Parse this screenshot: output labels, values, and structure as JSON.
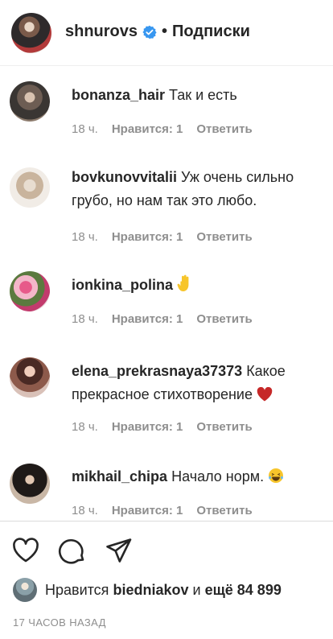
{
  "header": {
    "username": "shnurovs",
    "separator": "•",
    "follow_status": "Подписки"
  },
  "comments": [
    {
      "username": "bonanza_hair",
      "text": "Так и есть",
      "time": "18 ч.",
      "likes": "Нравится: 1",
      "reply": "Ответить"
    },
    {
      "username": "bovkunovvitalii",
      "text": "Уж очень сильно грубо, но нам так это любо.",
      "time": "18 ч.",
      "likes": "Нравится: 1",
      "reply": "Ответить"
    },
    {
      "username": "ionkina_polina",
      "text": "",
      "emoji": "hand-emoji",
      "time": "18 ч.",
      "likes": "Нравится: 1",
      "reply": "Ответить"
    },
    {
      "username": "elena_prekrasnaya37373",
      "text": "Какое прекрасное стихотворение",
      "emoji": "heart-emoji",
      "time": "18 ч.",
      "likes": "Нравится: 1",
      "reply": "Ответить"
    },
    {
      "username": "mikhail_chipa",
      "text": "Начало норм.",
      "emoji": "laughing-emoji",
      "time": "18 ч.",
      "likes": "Нравится: 1",
      "reply": "Ответить"
    }
  ],
  "actions": {
    "like_icon": "heart-outline-icon",
    "comment_icon": "comment-bubble-icon",
    "share_icon": "paper-plane-icon"
  },
  "likes": {
    "prefix": "Нравится",
    "user": "biedniakov",
    "conjunction": "и",
    "others": "ещё 84 899"
  },
  "timestamp": "17 ЧАСОВ НАЗАД",
  "colors": {
    "text": "#262626",
    "muted": "#8e8e8e",
    "verified": "#3897f0",
    "heart": "#c62828",
    "divider": "#dbdbdb"
  }
}
